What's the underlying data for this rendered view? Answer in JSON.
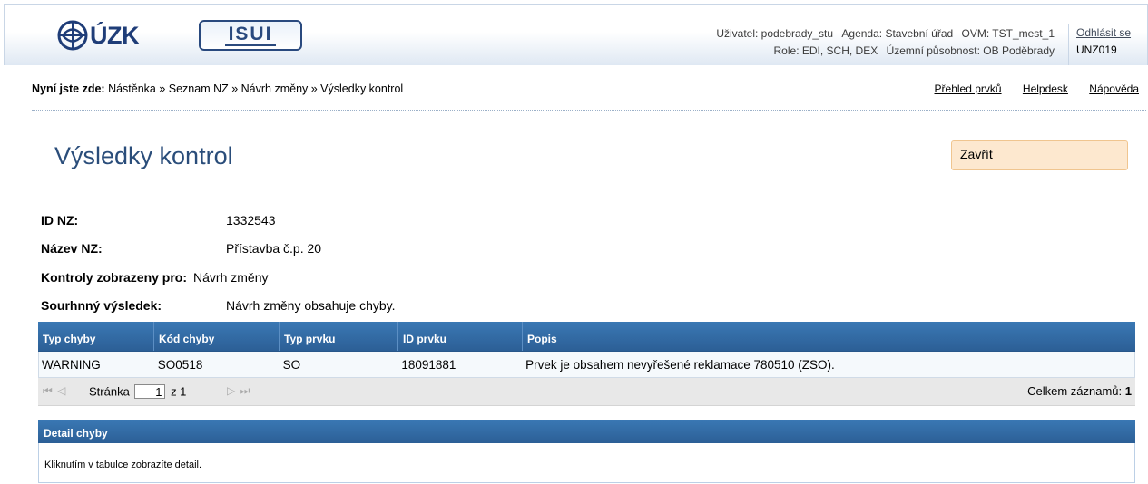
{
  "header": {
    "logo_cuzk": "ÚZK",
    "logo_isui": "ISUI",
    "user_line1": {
      "uzivatel": "Uživatel: podebrady_stu",
      "agenda": "Agenda: Stavební úřad",
      "ovm": "OVM: TST_mest_1"
    },
    "user_line2": {
      "role": "Role: EDI, SCH, DEX",
      "pusobnost": "Územní působnost: OB Poděbrady"
    },
    "logout": "Odhlásit se",
    "code": "UNZ019"
  },
  "breadcrumb": {
    "label": "Nyní jste zde:",
    "path": "Nástěnka » Seznam NZ » Návrh změny » Výsledky kontrol",
    "links": [
      "Přehled prvků",
      "Helpdesk",
      "Nápověda"
    ]
  },
  "page": {
    "title": "Výsledky kontrol",
    "close": "Zavřít"
  },
  "info": [
    {
      "key": "ID NZ:",
      "value": "1332543"
    },
    {
      "key": "Název NZ:",
      "value": "Přístavba č.p. 20"
    },
    {
      "key": "Kontroly zobrazeny pro:",
      "value": "Návrh změny"
    },
    {
      "key": "Sourhnný výsledek:",
      "value": "Návrh změny obsahuje chyby."
    }
  ],
  "grid": {
    "columns": [
      "Typ chyby",
      "Kód chyby",
      "Typ prvku",
      "ID prvku",
      "Popis"
    ],
    "rows": [
      [
        "WARNING",
        "SO0518",
        "SO",
        "18091881",
        "Prvek je obsahem nevyřešené reklamace 780510 (ZSO)."
      ]
    ],
    "pager": {
      "page_label": "Stránka",
      "page_value": "1",
      "of_label": "z 1",
      "total_label": "Celkem záznamů:",
      "total_value": "1"
    }
  },
  "detail": {
    "title": "Detail chyby",
    "text": "Kliknutím v tabulce zobrazíte detail."
  }
}
